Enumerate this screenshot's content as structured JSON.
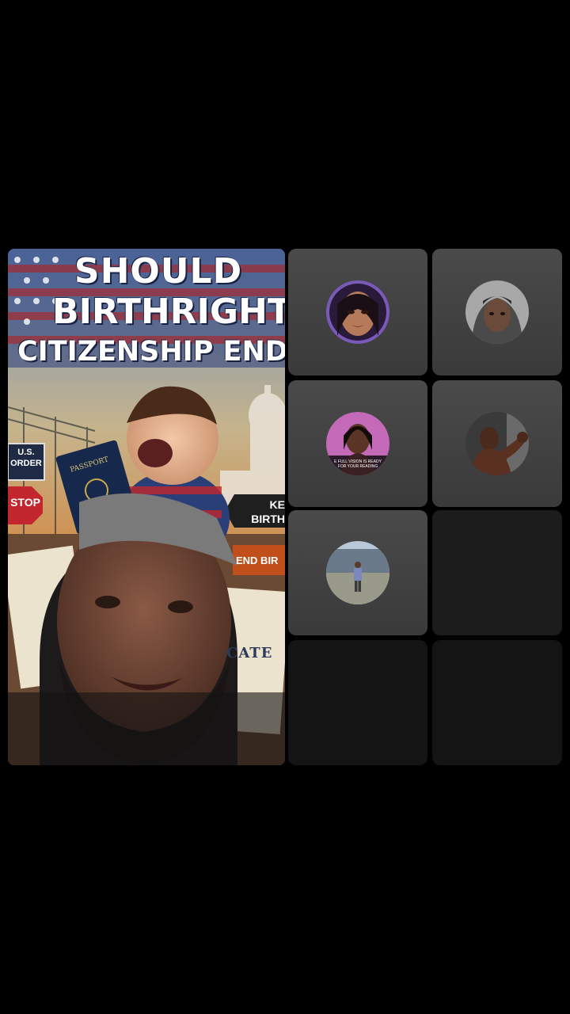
{
  "host": {
    "thumbnail_title_lines": [
      "SHOULD",
      "BIRTHRIGHT",
      "CITIZENSHIP END"
    ],
    "passport_label": "PASSPORT",
    "sign_us_border_lines": [
      "U.S.",
      "ORDER"
    ],
    "sign_stop": "STOP",
    "sign_keep_lines": [
      "KE",
      "BIRTH"
    ],
    "sign_end": "END BIR",
    "certificate_text": "CATE"
  },
  "guests": [
    {
      "avatar_icon": "woman-portrait-avatar"
    },
    {
      "avatar_icon": "man-hooded-portrait-avatar"
    },
    {
      "avatar_icon": "woman-promo-avatar",
      "avatar_caption_lines": [
        "E FULL VISION IS READY",
        "FOR YOUR READING"
      ]
    },
    {
      "avatar_icon": "man-flexing-avatar"
    },
    {
      "avatar_icon": "man-standing-avatar"
    }
  ],
  "colors": {
    "background": "#000000",
    "tile_active": "#444444",
    "tile_empty": "#1c1c1c"
  }
}
